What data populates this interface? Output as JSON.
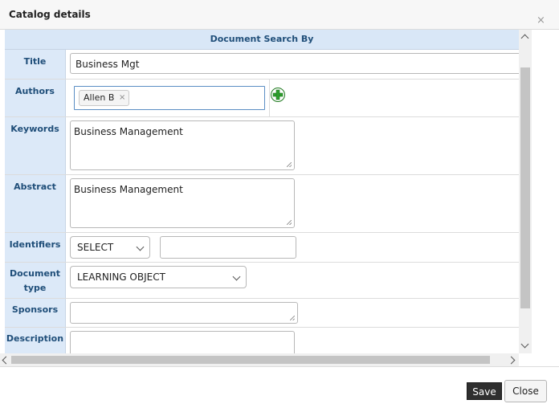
{
  "dialog": {
    "title": "Catalog details",
    "close_glyph": "×"
  },
  "form": {
    "section_header": "Document Search By",
    "title": {
      "label": "Title",
      "value": "Business Mgt"
    },
    "authors": {
      "label": "Authors",
      "tags": [
        "Allen B"
      ],
      "tag_remove_glyph": "×",
      "add_icon": "plus-circle-icon"
    },
    "keywords": {
      "label": "Keywords",
      "value": "Business Management"
    },
    "abstract": {
      "label": "Abstract",
      "value": "Business Management"
    },
    "identifiers": {
      "label": "Identifiers",
      "select_value": "SELECT",
      "text_value": ""
    },
    "document_type": {
      "label_line1": "Document",
      "label_line2": "type",
      "select_value": "LEARNING OBJECT"
    },
    "sponsors": {
      "label": "Sponsors",
      "value": ""
    },
    "description": {
      "label": "Description",
      "value": ""
    }
  },
  "footer": {
    "save_label": "Save",
    "close_label": "Close"
  },
  "colors": {
    "header_bg": "#d9e7f7",
    "label_text": "#1f4e79",
    "add_icon": "#2e9e2e",
    "save_bg": "#2f2f2f"
  }
}
